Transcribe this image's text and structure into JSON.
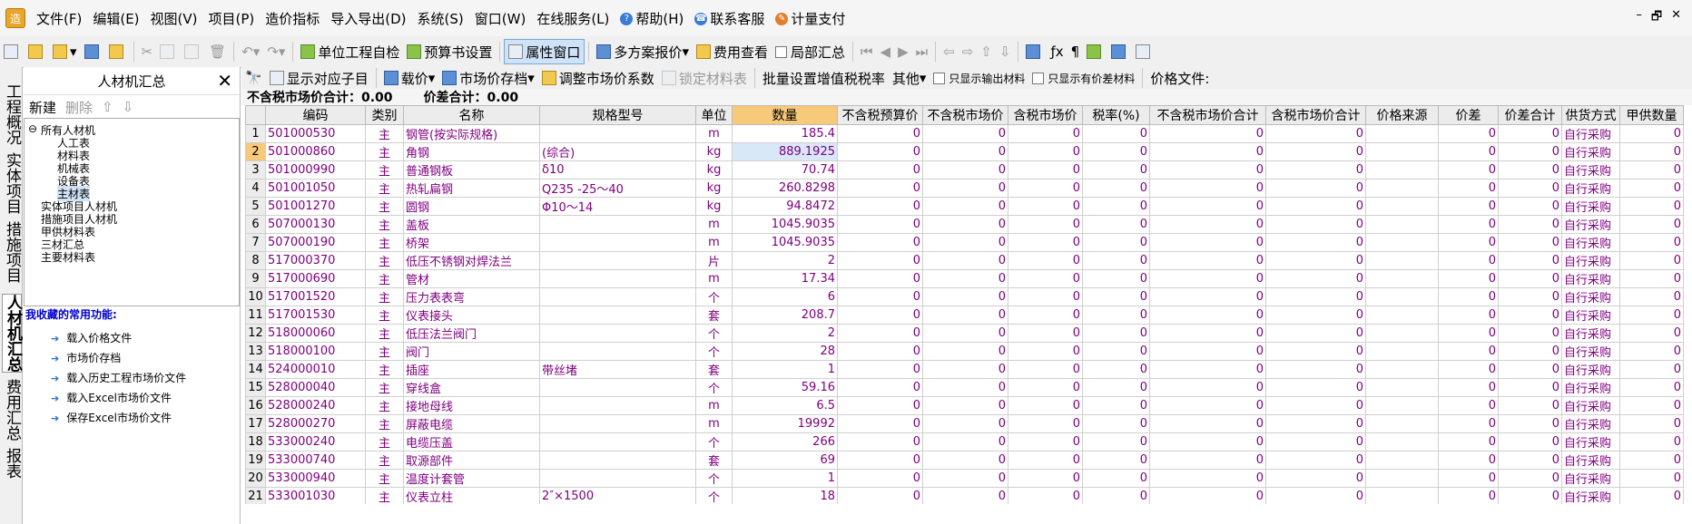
{
  "menu": {
    "items": [
      "文件(F)",
      "编辑(E)",
      "视图(V)",
      "项目(P)",
      "造价指标",
      "导入导出(D)",
      "系统(S)",
      "窗口(W)",
      "在线服务(L)",
      "帮助(H)",
      "联系客服",
      "计量支付"
    ],
    "win_controls": [
      "–",
      "🗗",
      "✕"
    ]
  },
  "toolbar": {
    "self_check": "单位工程自检",
    "budget_settings": "预算书设置",
    "property_window": "属性窗口",
    "multi_quote": "多方案报价",
    "fee_view": "费用查看",
    "local_summary": "局部汇总"
  },
  "vtabs": [
    "工程概况",
    "实体项目",
    "措施项目",
    "人材机汇总",
    "费用汇总",
    "报表"
  ],
  "panel": {
    "title": "人材机汇总",
    "new_label": "新建",
    "delete_label": "删除",
    "tree": [
      {
        "label": "所有人材机",
        "level": 0,
        "expander": "⊖"
      },
      {
        "label": "人工表",
        "level": 1
      },
      {
        "label": "材料表",
        "level": 1
      },
      {
        "label": "机械表",
        "level": 1
      },
      {
        "label": "设备表",
        "level": 1
      },
      {
        "label": "主材表",
        "level": 1,
        "selected": true
      },
      {
        "label": "实体项目人材机",
        "level": 0
      },
      {
        "label": "措施项目人材机",
        "level": 0
      },
      {
        "label": "甲供材料表",
        "level": 0
      },
      {
        "label": "三材汇总",
        "level": 0
      },
      {
        "label": "主要材料表",
        "level": 0
      }
    ],
    "favorites_title": "我收藏的常用功能:",
    "favorites": [
      "载入价格文件",
      "市场价存档",
      "载入历史工程市场价文件",
      "载入Excel市场价文件",
      "保存Excel市场价文件"
    ]
  },
  "subtoolbar": {
    "show_sub": "显示对应子目",
    "load_price": "载价",
    "market_archive": "市场价存档",
    "adjust_coef": "调整市场价系数",
    "lock_material": "锁定材料表",
    "batch_vat": "批量设置增值税税率",
    "other": "其他",
    "only_output": "只显示输出材料",
    "only_diff": "只显示有价差材料",
    "price_file": "价格文件:"
  },
  "summary": {
    "excl_tax_label": "不含税市场价合计：0.00",
    "diff_label": "价差合计：0.00"
  },
  "table": {
    "columns": [
      "",
      "编码",
      "类别",
      "名称",
      "规格型号",
      "单位",
      "数量",
      "不含税预算价",
      "不含税市场价",
      "含税市场价",
      "税率(%)",
      "不含税市场价合计",
      "含税市场价合计",
      "价格来源",
      "价差",
      "价差合计",
      "供货方式",
      "甲供数量"
    ],
    "rows": [
      [
        "1",
        "501000530",
        "主",
        "钢管(按实际规格)",
        "",
        "m",
        "185.4",
        "0",
        "0",
        "0",
        "0",
        "0",
        "0",
        "",
        "0",
        "0",
        "自行采购",
        "0"
      ],
      [
        "2",
        "501000860",
        "主",
        "角钢",
        "(综合)",
        "kg",
        "889.1925",
        "0",
        "0",
        "0",
        "0",
        "0",
        "0",
        "",
        "0",
        "0",
        "自行采购",
        "0"
      ],
      [
        "3",
        "501000990",
        "主",
        "普通钢板",
        "δ10",
        "kg",
        "70.74",
        "0",
        "0",
        "0",
        "0",
        "0",
        "0",
        "",
        "0",
        "0",
        "自行采购",
        "0"
      ],
      [
        "4",
        "501001050",
        "主",
        "热轧扁钢",
        "Q235 -25～40",
        "kg",
        "260.8298",
        "0",
        "0",
        "0",
        "0",
        "0",
        "0",
        "",
        "0",
        "0",
        "自行采购",
        "0"
      ],
      [
        "5",
        "501001270",
        "主",
        "圆钢",
        "Φ10～14",
        "kg",
        "94.8472",
        "0",
        "0",
        "0",
        "0",
        "0",
        "0",
        "",
        "0",
        "0",
        "自行采购",
        "0"
      ],
      [
        "6",
        "507000130",
        "主",
        "盖板",
        "",
        "m",
        "1045.9035",
        "0",
        "0",
        "0",
        "0",
        "0",
        "0",
        "",
        "0",
        "0",
        "自行采购",
        "0"
      ],
      [
        "7",
        "507000190",
        "主",
        "桥架",
        "",
        "m",
        "1045.9035",
        "0",
        "0",
        "0",
        "0",
        "0",
        "0",
        "",
        "0",
        "0",
        "自行采购",
        "0"
      ],
      [
        "8",
        "517000370",
        "主",
        "低压不锈钢对焊法兰",
        "",
        "片",
        "2",
        "0",
        "0",
        "0",
        "0",
        "0",
        "0",
        "",
        "0",
        "0",
        "自行采购",
        "0"
      ],
      [
        "9",
        "517000690",
        "主",
        "管材",
        "",
        "m",
        "17.34",
        "0",
        "0",
        "0",
        "0",
        "0",
        "0",
        "",
        "0",
        "0",
        "自行采购",
        "0"
      ],
      [
        "10",
        "517001520",
        "主",
        "压力表表弯",
        "",
        "个",
        "6",
        "0",
        "0",
        "0",
        "0",
        "0",
        "0",
        "",
        "0",
        "0",
        "自行采购",
        "0"
      ],
      [
        "11",
        "517001530",
        "主",
        "仪表接头",
        "",
        "套",
        "208.7",
        "0",
        "0",
        "0",
        "0",
        "0",
        "0",
        "",
        "0",
        "0",
        "自行采购",
        "0"
      ],
      [
        "12",
        "518000060",
        "主",
        "低压法兰阀门",
        "",
        "个",
        "2",
        "0",
        "0",
        "0",
        "0",
        "0",
        "0",
        "",
        "0",
        "0",
        "自行采购",
        "0"
      ],
      [
        "13",
        "518000100",
        "主",
        "阀门",
        "",
        "个",
        "28",
        "0",
        "0",
        "0",
        "0",
        "0",
        "0",
        "",
        "0",
        "0",
        "自行采购",
        "0"
      ],
      [
        "14",
        "524000010",
        "主",
        "插座",
        "带丝堵",
        "套",
        "1",
        "0",
        "0",
        "0",
        "0",
        "0",
        "0",
        "",
        "0",
        "0",
        "自行采购",
        "0"
      ],
      [
        "15",
        "528000040",
        "主",
        "穿线盒",
        "",
        "个",
        "59.16",
        "0",
        "0",
        "0",
        "0",
        "0",
        "0",
        "",
        "0",
        "0",
        "自行采购",
        "0"
      ],
      [
        "16",
        "528000240",
        "主",
        "接地母线",
        "",
        "m",
        "6.5",
        "0",
        "0",
        "0",
        "0",
        "0",
        "0",
        "",
        "0",
        "0",
        "自行采购",
        "0"
      ],
      [
        "17",
        "528000270",
        "主",
        "屏蔽电缆",
        "",
        "m",
        "19992",
        "0",
        "0",
        "0",
        "0",
        "0",
        "0",
        "",
        "0",
        "0",
        "自行采购",
        "0"
      ],
      [
        "18",
        "533000240",
        "主",
        "电缆压盖",
        "",
        "个",
        "266",
        "0",
        "0",
        "0",
        "0",
        "0",
        "0",
        "",
        "0",
        "0",
        "自行采购",
        "0"
      ],
      [
        "19",
        "533000740",
        "主",
        "取源部件",
        "",
        "套",
        "69",
        "0",
        "0",
        "0",
        "0",
        "0",
        "0",
        "",
        "0",
        "0",
        "自行采购",
        "0"
      ],
      [
        "20",
        "533000940",
        "主",
        "温度计套管",
        "",
        "个",
        "1",
        "0",
        "0",
        "0",
        "0",
        "0",
        "0",
        "",
        "0",
        "0",
        "自行采购",
        "0"
      ],
      [
        "21",
        "533001030",
        "主",
        "仪表立柱",
        "2″×1500",
        "个",
        "18",
        "0",
        "0",
        "0",
        "0",
        "0",
        "0",
        "",
        "0",
        "0",
        "自行采购",
        "0"
      ]
    ]
  }
}
